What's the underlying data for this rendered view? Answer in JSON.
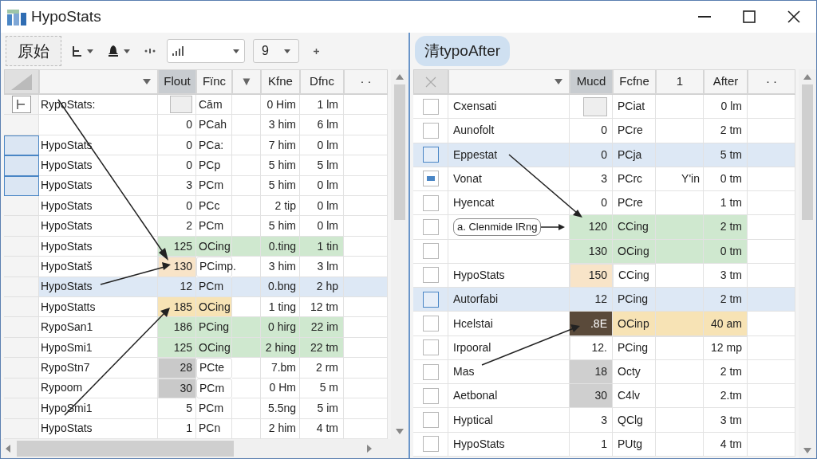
{
  "window": {
    "title": "HypoStats"
  },
  "left_pane": {
    "mode_button": "原始",
    "size_dropdown": "9",
    "columns": [
      {
        "label": "Flout",
        "selected": true
      },
      {
        "label": "Fïnc",
        "selected": false
      },
      {
        "label": "▼",
        "selected": false
      },
      {
        "label": "Kfne",
        "selected": false
      },
      {
        "label": "Dfnc",
        "selected": false
      },
      {
        "label": "· ·",
        "selected": false
      }
    ],
    "rows": [
      {
        "name": "RypoStats:",
        "num": "",
        "code": "Cām",
        "a": "0 Him",
        "b": "1 lm",
        "kind": "plain",
        "selected": false,
        "highlighted": false,
        "expander": true
      },
      {
        "name": "",
        "num": "0",
        "code": "PCah",
        "a": "3 him",
        "b": "6 lm",
        "kind": "plain",
        "selected": false,
        "highlighted": false,
        "expander": false
      },
      {
        "name": "HypoStats",
        "num": "0",
        "code": "PCa:",
        "a": "7 him",
        "b": "0 lm",
        "kind": "plain",
        "selected": true,
        "highlighted": false,
        "expander": false
      },
      {
        "name": "HypoStats",
        "num": "0",
        "code": "PCp",
        "a": "5 him",
        "b": "5 lm",
        "kind": "plain",
        "selected": true,
        "highlighted": false,
        "expander": false
      },
      {
        "name": "HypoStats",
        "num": "3",
        "code": "PCm",
        "a": "5 him",
        "b": "0 lm",
        "kind": "plain",
        "selected": true,
        "highlighted": false,
        "expander": false
      },
      {
        "name": "HypoStats",
        "num": "0",
        "code": "PCc",
        "a": "2 tip",
        "b": "0 lm",
        "kind": "plain",
        "selected": false,
        "highlighted": false,
        "expander": false
      },
      {
        "name": "HypoStats",
        "num": "2",
        "code": "PCm",
        "a": "5 him",
        "b": "0 lm",
        "kind": "plain",
        "selected": false,
        "highlighted": false,
        "expander": false
      },
      {
        "name": "HypoStats",
        "num": "125",
        "code": "OCing",
        "a": "0.ting",
        "b": "1 tin",
        "kind": "matched",
        "selected": false,
        "highlighted": false,
        "expander": false
      },
      {
        "name": "HypoStatš",
        "num": "130",
        "code": "PCimp.",
        "a": "3 him",
        "b": "3 lm",
        "kind": "edited",
        "selected": false,
        "highlighted": false,
        "expander": false
      },
      {
        "name": "HypoStats",
        "num": "12",
        "code": "PCm",
        "a": "0.bng",
        "b": "2 hp",
        "kind": "plain",
        "selected": false,
        "highlighted": true,
        "expander": false
      },
      {
        "name": "HypoStatts",
        "num": "185",
        "code": "OCing",
        "a": "1 ting",
        "b": "12 tm",
        "kind": "changed",
        "selected": false,
        "highlighted": false,
        "expander": false
      },
      {
        "name": "RypoSan1",
        "num": "186",
        "code": "PCing",
        "a": "0 hirg",
        "b": "22 im",
        "kind": "matched",
        "selected": false,
        "highlighted": false,
        "expander": false
      },
      {
        "name": "HypoSmi1",
        "num": "125",
        "code": "OCing",
        "a": "2 hing",
        "b": "22 tm",
        "kind": "matched",
        "selected": false,
        "highlighted": false,
        "expander": false
      },
      {
        "name": "RypoStn7",
        "num": "28",
        "code": "PCte",
        "a": "7.bm",
        "b": "2 rm",
        "kind": "flagged",
        "selected": false,
        "highlighted": false,
        "expander": false
      },
      {
        "name": "Rypoom",
        "num": "30",
        "code": "PCm",
        "a": "0 Hm",
        "b": "5 m",
        "kind": "flagged",
        "selected": false,
        "highlighted": false,
        "expander": false
      },
      {
        "name": "HypoSmi1",
        "num": "5",
        "code": "PCm",
        "a": "5.5ng",
        "b": "5 im",
        "kind": "plain",
        "selected": false,
        "highlighted": false,
        "expander": false
      },
      {
        "name": "HypoStats",
        "num": "1",
        "code": "PCn",
        "a": "2 him",
        "b": "4 tm",
        "kind": "plain",
        "selected": false,
        "highlighted": false,
        "expander": false
      }
    ]
  },
  "right_pane": {
    "mode_button": "清typoAfter",
    "columns": [
      {
        "label": "Mucd",
        "selected": true
      },
      {
        "label": "Fcfne",
        "selected": false
      },
      {
        "label": "1",
        "selected": false
      },
      {
        "label": "After",
        "selected": false
      },
      {
        "label": "· ·",
        "selected": false
      }
    ],
    "rows": [
      {
        "name": "Cxensati",
        "num": "",
        "code": "PCiat",
        "extra": "",
        "value": "0 lm",
        "kind": "plain",
        "checked": false,
        "selected": false
      },
      {
        "name": "Aunofolt",
        "num": "0",
        "code": "PCre",
        "extra": "",
        "value": "2 tm",
        "kind": "plain",
        "checked": false,
        "selected": false
      },
      {
        "name": "Eppestat",
        "num": "0",
        "code": "PCja",
        "extra": "",
        "value": "5 tm",
        "kind": "plain",
        "checked": false,
        "selected": true
      },
      {
        "name": "Vonat",
        "num": "3",
        "code": "PCrc",
        "extra": "Y'in",
        "value": "0 tm",
        "kind": "plain",
        "checked": true,
        "selected": false
      },
      {
        "name": "Hyencat",
        "num": "0",
        "code": "PCre",
        "extra": "",
        "value": "1 tm",
        "kind": "plain",
        "checked": false,
        "selected": false
      },
      {
        "name": "",
        "callout": "a. Clenmide IRng",
        "num": "120",
        "code": "CCing",
        "extra": "",
        "value": "2 tm",
        "kind": "matched",
        "checked": false,
        "selected": false
      },
      {
        "name": "",
        "num": "130",
        "code": "OCing",
        "extra": "",
        "value": "0 tm",
        "kind": "matched",
        "checked": false,
        "selected": false
      },
      {
        "name": "HypoStats",
        "num": "150",
        "code": "CCing",
        "extra": "",
        "value": "3 tm",
        "kind": "edited",
        "checked": false,
        "selected": false
      },
      {
        "name": "Autorfabi",
        "num": "12",
        "code": "PCing",
        "extra": "",
        "value": "2 tm",
        "kind": "plain",
        "checked": false,
        "selected": true
      },
      {
        "name": "Hcelstai",
        "num": ".8E",
        "code": "OCinp",
        "extra": "",
        "value": "40 am",
        "kind": "changed",
        "checked": false,
        "selected": false
      },
      {
        "name": "Irpooral",
        "num": "12.",
        "code": "PCing",
        "extra": "",
        "value": "12 mp",
        "kind": "popup",
        "checked": false,
        "selected": false
      },
      {
        "name": "Mas",
        "num": "18",
        "code": "Octy",
        "extra": "",
        "value": "2 tm",
        "kind": "flagged",
        "checked": false,
        "selected": false
      },
      {
        "name": "Aetbonal",
        "num": "30",
        "code": "C4lv",
        "extra": "",
        "value": "2.tm",
        "kind": "flagged",
        "checked": false,
        "selected": false
      },
      {
        "name": "Hyptical",
        "num": "3",
        "code": "QClg",
        "extra": "",
        "value": "3 tm",
        "kind": "plain",
        "checked": false,
        "selected": false
      },
      {
        "name": "HypoStats",
        "num": "1",
        "code": "PUtg",
        "extra": "",
        "value": "4 tm",
        "kind": "plain",
        "checked": false,
        "selected": false
      }
    ]
  }
}
